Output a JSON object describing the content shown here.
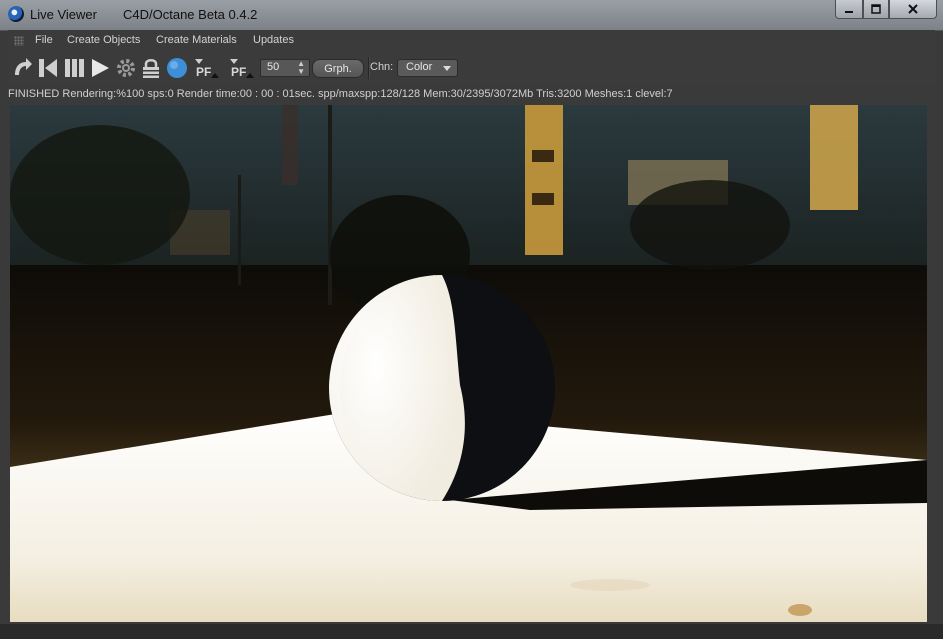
{
  "window": {
    "title": "Live Viewer",
    "subtitle": "C4D/Octane Beta 0.4.2",
    "controls": [
      "minimize",
      "maximize",
      "close"
    ]
  },
  "menu": {
    "items": [
      "File",
      "Create Objects",
      "Create Materials",
      "Updates"
    ]
  },
  "toolbar": {
    "icons": [
      "restart-icon",
      "stop-icon",
      "pause-icon",
      "play-icon",
      "settings-icon",
      "lock-icon",
      "sphere-icon",
      "pf-icon",
      "pf-alt-icon"
    ],
    "pf_label": "PF",
    "spin_value": "50",
    "graph_label": "Grph.",
    "channel_label": "Chn:",
    "channel_value": "Color"
  },
  "status": {
    "text": "FINISHED Rendering:%100 sps:0 Render time:00 : 00 : 01sec. spp/maxspp:128/128 Mem:30/2395/3072Mb Tris:3200 Meshes:1 clevel:7"
  },
  "colors": {
    "accent_blue": "#3d8fd8",
    "icon_gray": "#cfcfcf",
    "panel": "#3b3b3b"
  }
}
